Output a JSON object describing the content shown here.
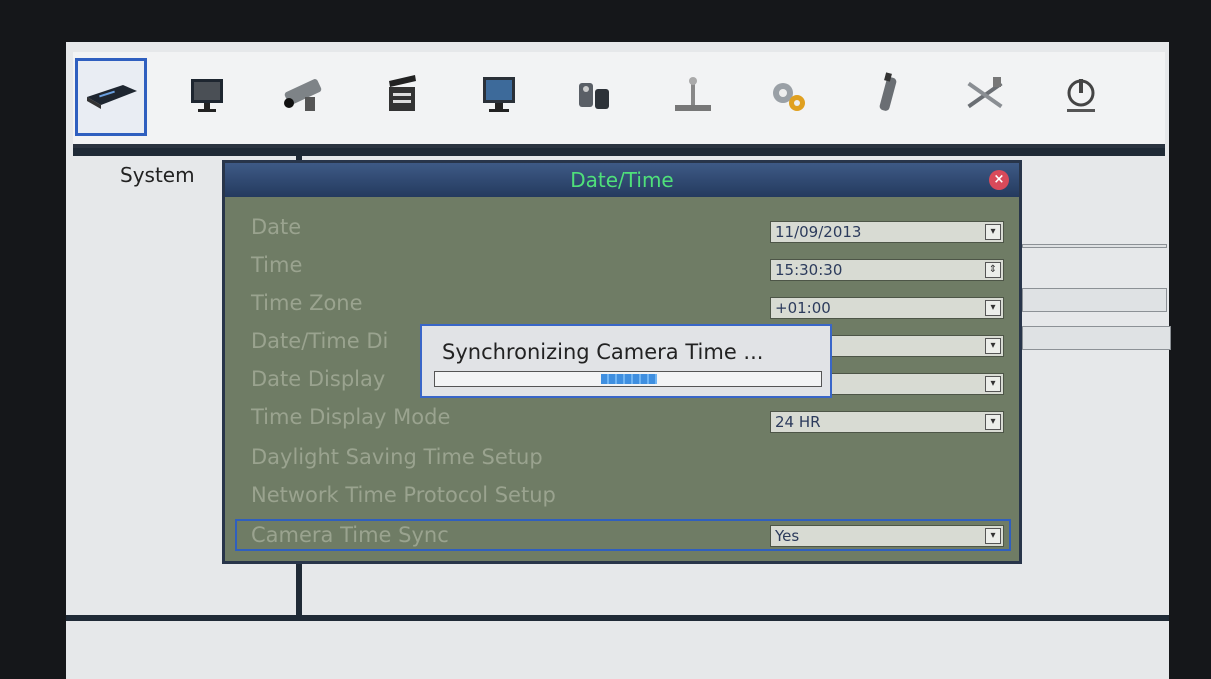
{
  "toolbar": {
    "items": [
      {
        "icon": "dvr-icon",
        "active": true
      },
      {
        "icon": "monitor-icon"
      },
      {
        "icon": "camera-icon"
      },
      {
        "icon": "clapperboard-icon"
      },
      {
        "icon": "display-icon"
      },
      {
        "icon": "storage-icon"
      },
      {
        "icon": "joystick-icon"
      },
      {
        "icon": "gears-icon"
      },
      {
        "icon": "usb-icon"
      },
      {
        "icon": "tools-icon"
      },
      {
        "icon": "power-icon"
      }
    ]
  },
  "left_panel": {
    "title": "System"
  },
  "dialog": {
    "title": "Date/Time",
    "rows": [
      {
        "label": "Date",
        "value": "11/09/2013",
        "control": "dropdown"
      },
      {
        "label": "Time",
        "value": "15:30:30",
        "control": "spinner"
      },
      {
        "label": "Time Zone",
        "value": "+01:00",
        "control": "dropdown"
      },
      {
        "label": "Date/Time Di",
        "value": "",
        "control": "dropdown"
      },
      {
        "label": "Date Display",
        "value": "",
        "control": "dropdown"
      },
      {
        "label": "Time Display Mode",
        "value": "24 HR",
        "control": "dropdown"
      },
      {
        "label": "Daylight Saving Time Setup"
      },
      {
        "label": "Network Time Protocol Setup"
      },
      {
        "label": "Camera Time Sync",
        "value": "Yes",
        "control": "dropdown"
      }
    ]
  },
  "popup": {
    "message": "Synchronizing Camera Time ...",
    "progress_fraction": 0.5
  },
  "colors": {
    "accent": "#2f5fbf",
    "dialog_bg": "#6f7c65",
    "title_text": "#4fe07a"
  }
}
